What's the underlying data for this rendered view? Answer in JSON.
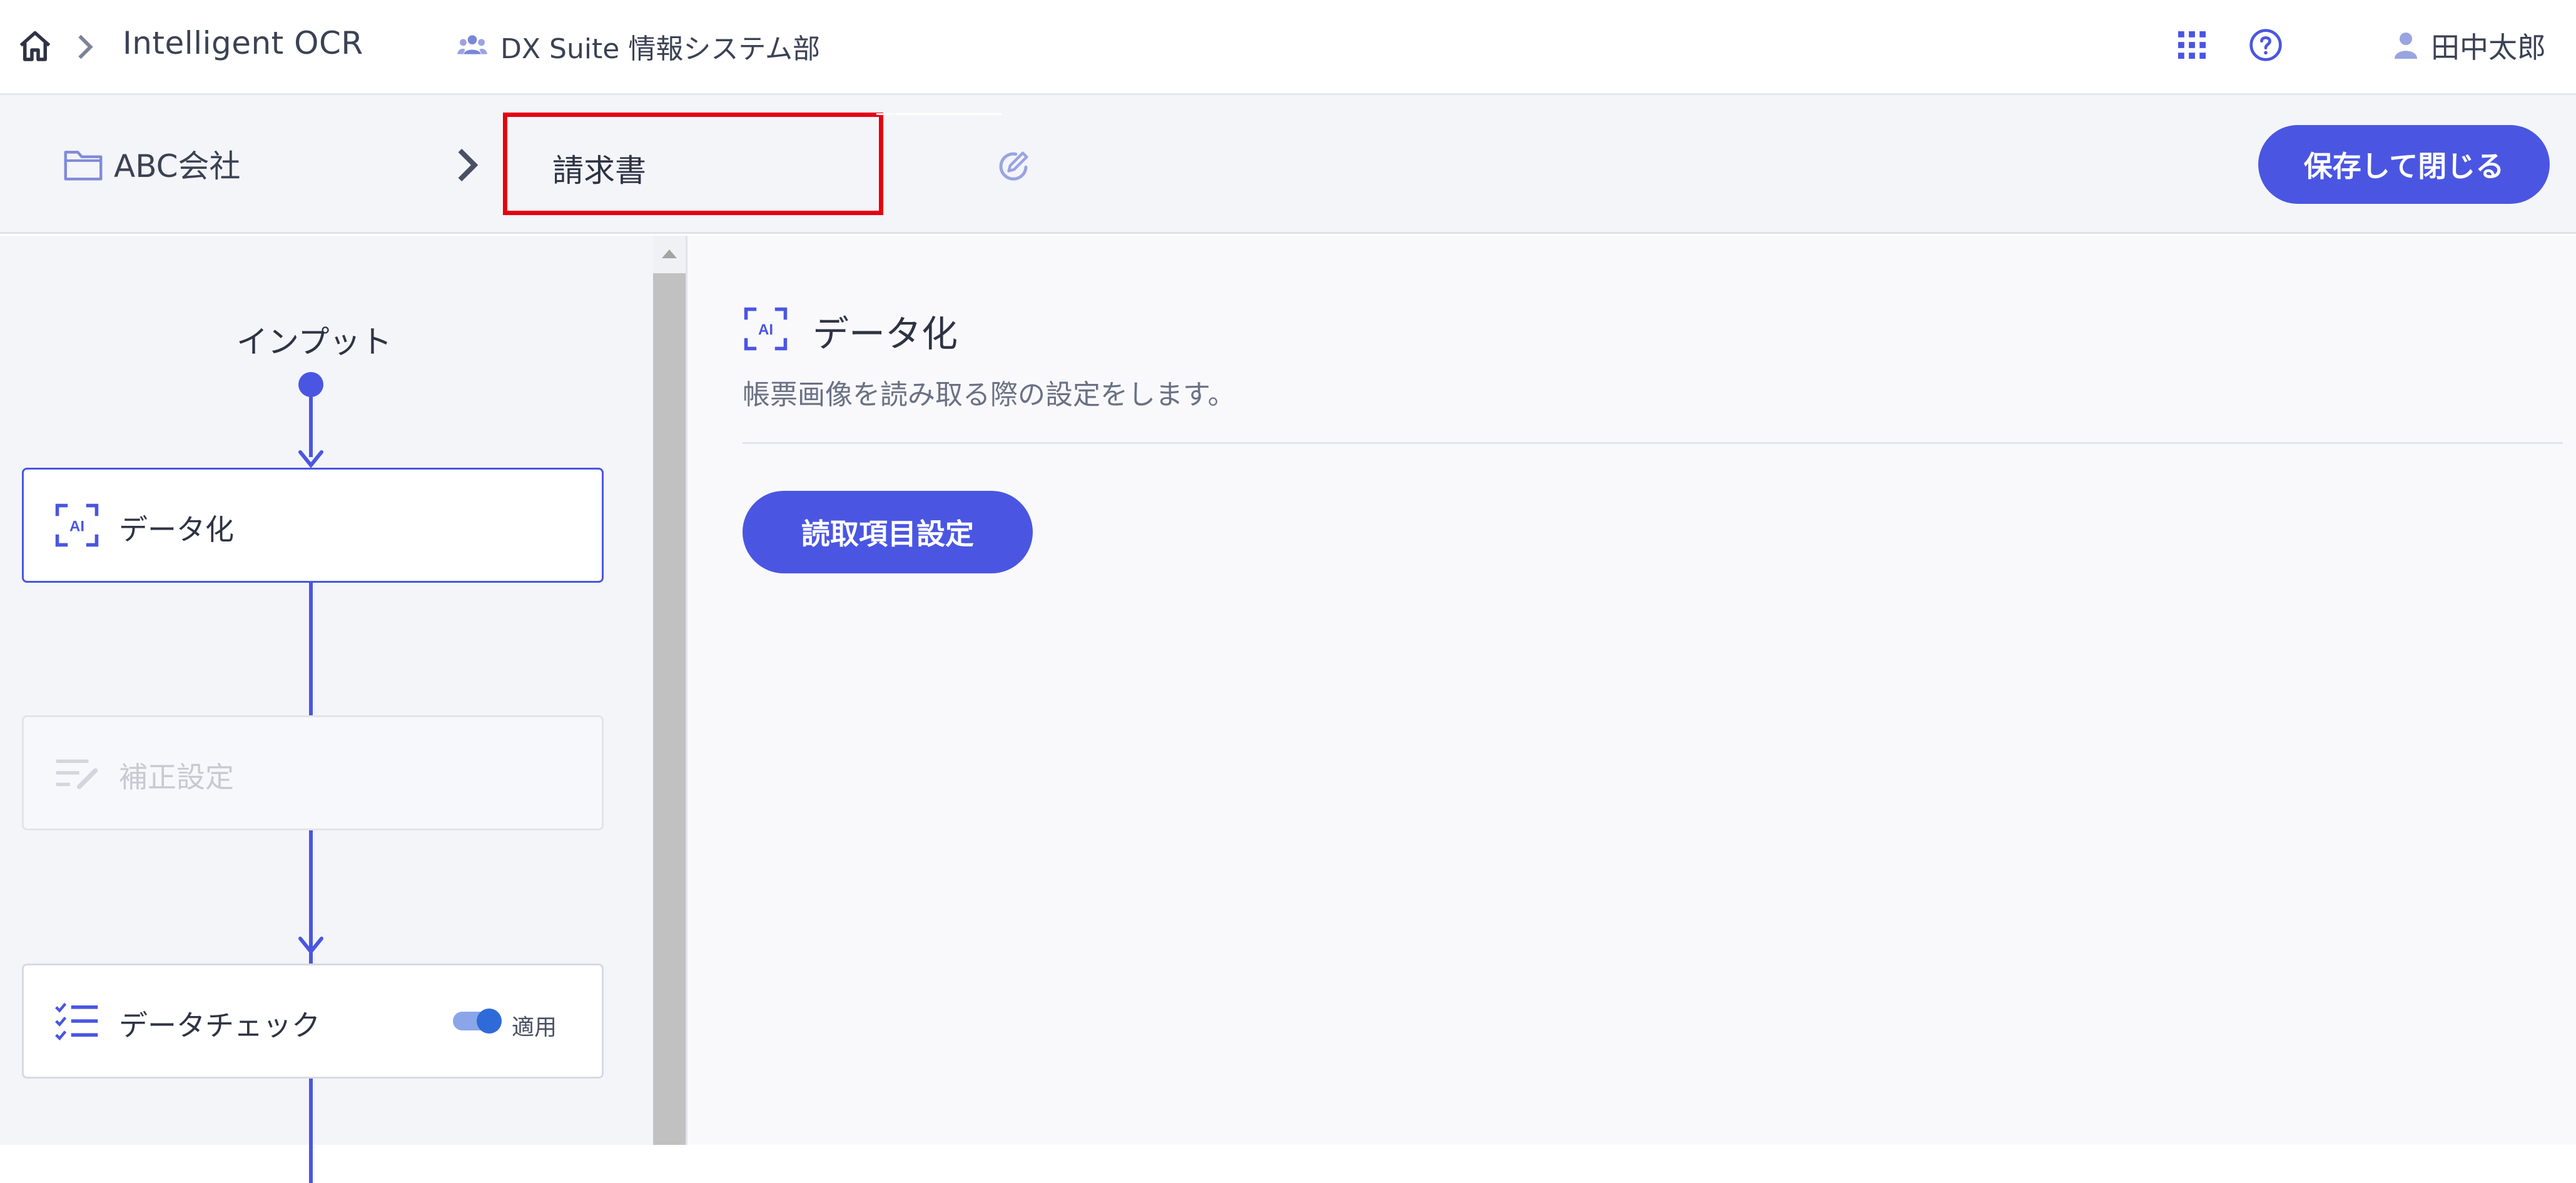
{
  "header": {
    "app_title": "Intelligent OCR",
    "org_name": "DX Suite 情報システム部",
    "user_name": "田中太郎"
  },
  "subheader": {
    "folder_name": "ABC会社",
    "document_name": "請求書",
    "save_close_label": "保存して閉じる"
  },
  "flow": {
    "input_label": "インプット",
    "nodes": [
      {
        "label": "データ化",
        "state": "active"
      },
      {
        "label": "補正設定",
        "state": "disabled"
      },
      {
        "label": "データチェック",
        "state": "normal",
        "toggle_label": "適用",
        "toggle_on": true
      }
    ],
    "ai_icon_text": "AI"
  },
  "main": {
    "title": "データ化",
    "description": "帳票画像を読み取る際の設定をします。",
    "reading_button_label": "読取項目設定"
  },
  "colors": {
    "accent": "#4a56e2",
    "highlight_box": "#e60012",
    "toggle_knob": "#2f6bd8"
  }
}
